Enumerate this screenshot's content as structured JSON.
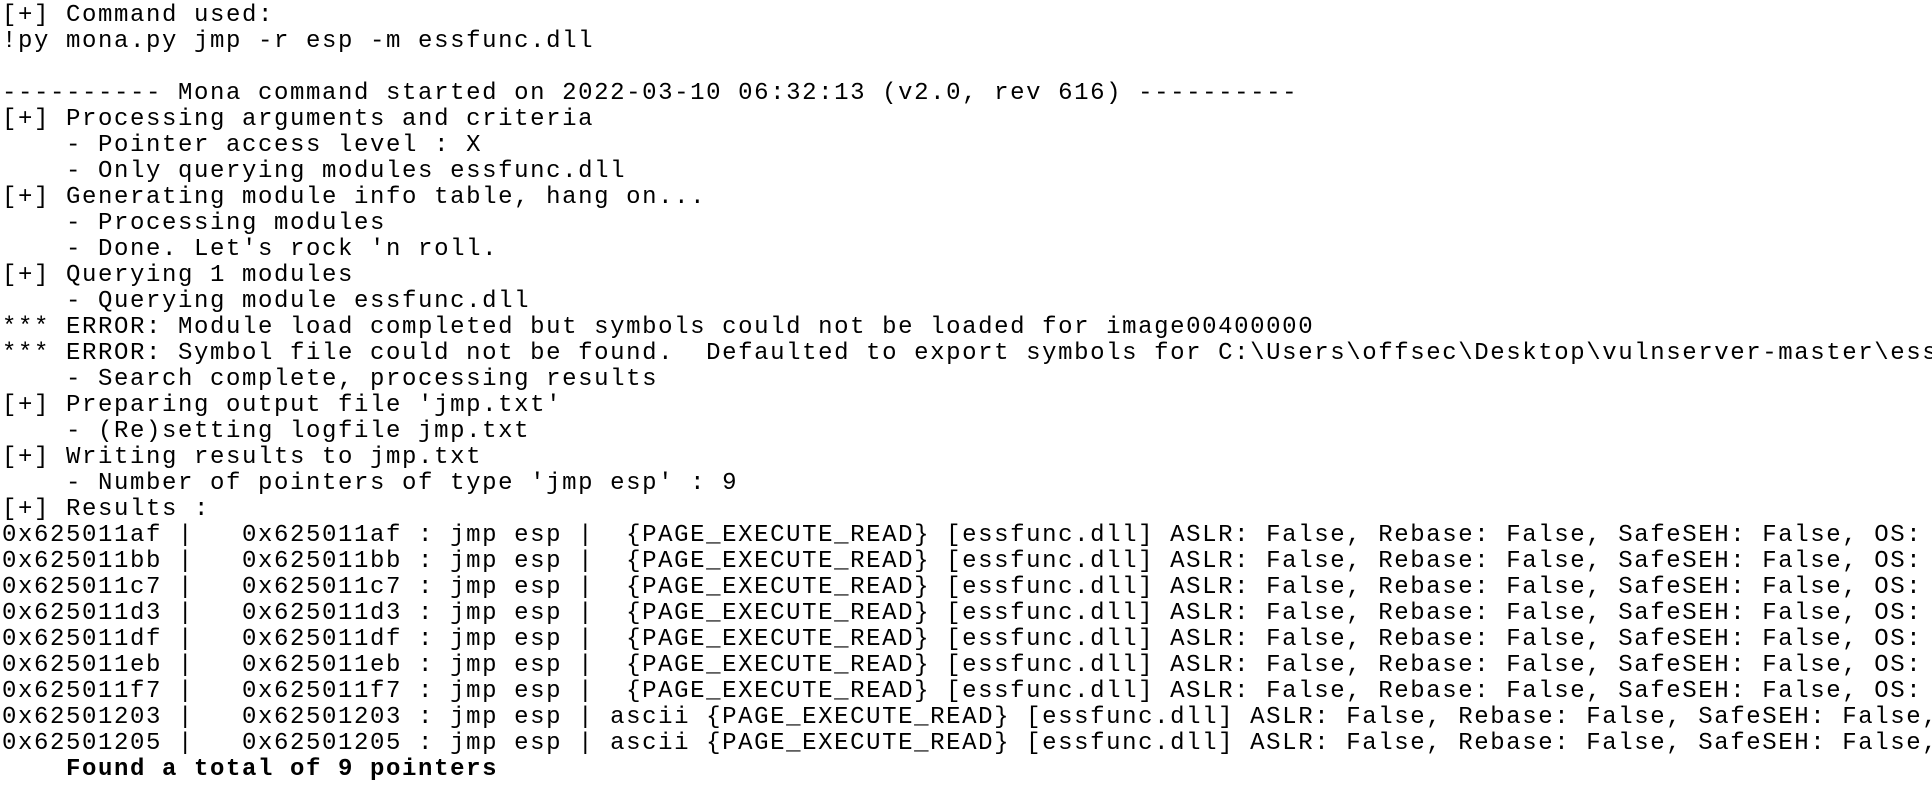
{
  "log": {
    "lines": [
      "[+] Command used:",
      "!py mona.py jmp -r esp -m essfunc.dll",
      "",
      "---------- Mona command started on 2022-03-10 06:32:13 (v2.0, rev 616) ----------",
      "[+] Processing arguments and criteria",
      "    - Pointer access level : X",
      "    - Only querying modules essfunc.dll",
      "[+] Generating module info table, hang on...",
      "    - Processing modules",
      "    - Done. Let's rock 'n roll.",
      "[+] Querying 1 modules",
      "    - Querying module essfunc.dll",
      "*** ERROR: Module load completed but symbols could not be loaded for image00400000",
      "*** ERROR: Symbol file could not be found.  Defaulted to export symbols for C:\\Users\\offsec\\Desktop\\vulnserver-master\\ess",
      "    - Search complete, processing results",
      "[+] Preparing output file 'jmp.txt'",
      "    - (Re)setting logfile jmp.txt",
      "[+] Writing results to jmp.txt",
      "    - Number of pointers of type 'jmp esp' : 9",
      "[+] Results :"
    ]
  },
  "results": {
    "rows": [
      "0x625011af |   0x625011af : jmp esp |  {PAGE_EXECUTE_READ} [essfunc.dll] ASLR: False, Rebase: False, SafeSEH: False, OS:",
      "0x625011bb |   0x625011bb : jmp esp |  {PAGE_EXECUTE_READ} [essfunc.dll] ASLR: False, Rebase: False, SafeSEH: False, OS:",
      "0x625011c7 |   0x625011c7 : jmp esp |  {PAGE_EXECUTE_READ} [essfunc.dll] ASLR: False, Rebase: False, SafeSEH: False, OS:",
      "0x625011d3 |   0x625011d3 : jmp esp |  {PAGE_EXECUTE_READ} [essfunc.dll] ASLR: False, Rebase: False, SafeSEH: False, OS:",
      "0x625011df |   0x625011df : jmp esp |  {PAGE_EXECUTE_READ} [essfunc.dll] ASLR: False, Rebase: False, SafeSEH: False, OS:",
      "0x625011eb |   0x625011eb : jmp esp |  {PAGE_EXECUTE_READ} [essfunc.dll] ASLR: False, Rebase: False, SafeSEH: False, OS:",
      "0x625011f7 |   0x625011f7 : jmp esp |  {PAGE_EXECUTE_READ} [essfunc.dll] ASLR: False, Rebase: False, SafeSEH: False, OS:",
      "0x62501203 |   0x62501203 : jmp esp | ascii {PAGE_EXECUTE_READ} [essfunc.dll] ASLR: False, Rebase: False, SafeSEH: False,",
      "0x62501205 |   0x62501205 : jmp esp | ascii {PAGE_EXECUTE_READ} [essfunc.dll] ASLR: False, Rebase: False, SafeSEH: False,"
    ],
    "summary": "    Found a total of 9 pointers"
  }
}
